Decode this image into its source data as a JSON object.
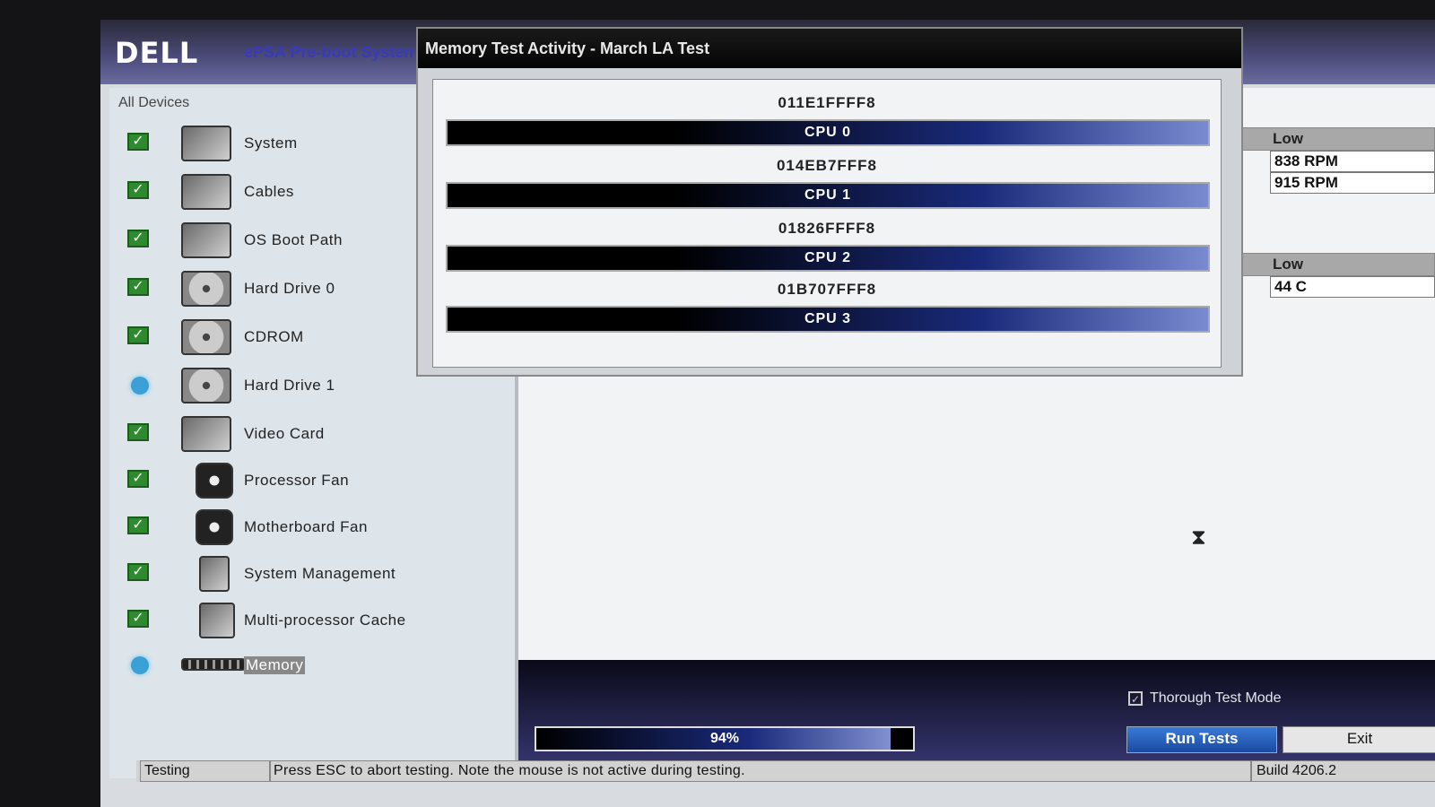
{
  "header": {
    "brand": "DELL",
    "title": "ePSA Pre-boot System Assessment"
  },
  "sidebar": {
    "heading": "All Devices",
    "items": [
      {
        "label": "System",
        "status": "passed",
        "icon": "laptop-icon"
      },
      {
        "label": "Cables",
        "status": "passed",
        "icon": "cable-icon"
      },
      {
        "label": "OS Boot Path",
        "status": "passed",
        "icon": "boot-path-icon"
      },
      {
        "label": "Hard Drive 0",
        "status": "passed",
        "icon": "hard-drive-icon"
      },
      {
        "label": "CDROM",
        "status": "passed",
        "icon": "cdrom-icon"
      },
      {
        "label": "Hard Drive 1",
        "status": "pending",
        "icon": "hard-drive-icon"
      },
      {
        "label": "Video Card",
        "status": "passed",
        "icon": "video-card-icon"
      },
      {
        "label": "Processor Fan",
        "status": "passed",
        "icon": "fan-icon"
      },
      {
        "label": "Motherboard Fan",
        "status": "passed",
        "icon": "fan-icon"
      },
      {
        "label": "System Management",
        "status": "passed",
        "icon": "system-management-icon"
      },
      {
        "label": "Multi-processor Cache",
        "status": "passed",
        "icon": "cpu-chip-icon"
      },
      {
        "label": "Memory",
        "status": "testing",
        "icon": "memory-icon"
      }
    ]
  },
  "dialog": {
    "title": "Memory Test Activity - March LA Test",
    "cpus": [
      {
        "address": "011E1FFFF8",
        "label": "CPU 0"
      },
      {
        "address": "014EB7FFF8",
        "label": "CPU 1"
      },
      {
        "address": "01826FFFF8",
        "label": "CPU 2"
      },
      {
        "address": "01B707FFF8",
        "label": "CPU 3"
      }
    ]
  },
  "readings": {
    "fan": {
      "header": "Low",
      "rows": [
        "838 RPM",
        "915 RPM"
      ]
    },
    "temp": {
      "header": "Low",
      "rows": [
        "44 C"
      ]
    }
  },
  "controls": {
    "progress_label": "94%",
    "progress_value": 0.94,
    "thorough_label": "Thorough Test Mode",
    "thorough_checked": true,
    "run_label": "Run Tests",
    "exit_label": "Exit"
  },
  "status_bar": {
    "state": "Testing",
    "message": "Press ESC to abort testing.  Note the mouse is not active during testing.",
    "build": "Build  4206.2"
  },
  "colors": {
    "check": "#2d8a2d",
    "pending": "#3aa0d6",
    "bar_dark": "#000000",
    "bar_light": "#7a8ad0"
  }
}
